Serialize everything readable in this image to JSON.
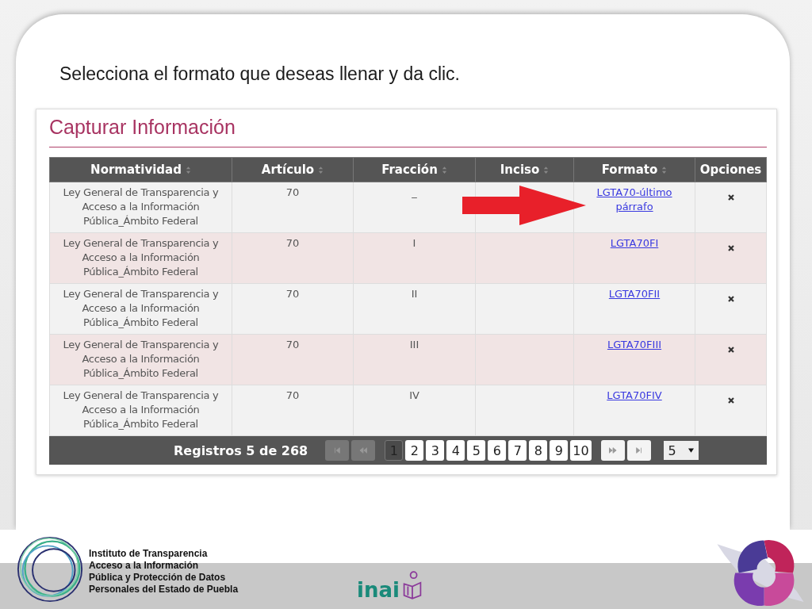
{
  "instruction": "Selecciona el formato que deseas llenar y da clic.",
  "panel": {
    "title": "Capturar Información",
    "table": {
      "columns": [
        {
          "label": "Normatividad",
          "sortable": true
        },
        {
          "label": "Artículo",
          "sortable": true
        },
        {
          "label": "Fracción",
          "sortable": true
        },
        {
          "label": "Inciso",
          "sortable": true
        },
        {
          "label": "Formato",
          "sortable": true
        },
        {
          "label": "Opciones",
          "sortable": false
        }
      ],
      "rows": [
        {
          "normatividad": "Ley General de Transparencia y Acceso a la Información Pública_Ámbito Federal",
          "articulo": "70",
          "fraccion": "_",
          "inciso": "",
          "formato": "LGTA70-último párrafo",
          "pointed": true
        },
        {
          "normatividad": "Ley General de Transparencia y Acceso a la Información Pública_Ámbito Federal",
          "articulo": "70",
          "fraccion": "I",
          "inciso": "",
          "formato": "LGTA70FI",
          "pointed": false
        },
        {
          "normatividad": "Ley General de Transparencia y Acceso a la Información Pública_Ámbito Federal",
          "articulo": "70",
          "fraccion": "II",
          "inciso": "",
          "formato": "LGTA70FII",
          "pointed": false
        },
        {
          "normatividad": "Ley General de Transparencia y Acceso a la Información Pública_Ámbito Federal",
          "articulo": "70",
          "fraccion": "III",
          "inciso": "",
          "formato": "LGTA70FIII",
          "pointed": false
        },
        {
          "normatividad": "Ley General de Transparencia y Acceso a la Información Pública_Ámbito Federal",
          "articulo": "70",
          "fraccion": "IV",
          "inciso": "",
          "formato": "LGTA70FIV",
          "pointed": false
        }
      ]
    },
    "pager": {
      "summary": "Registros 5 de 268",
      "nav_before": [
        {
          "kind": "first",
          "disabled": true
        },
        {
          "kind": "prev",
          "disabled": true
        }
      ],
      "pages": [
        {
          "label": "1",
          "selected": true
        },
        {
          "label": "2",
          "selected": false
        },
        {
          "label": "3",
          "selected": false
        },
        {
          "label": "4",
          "selected": false
        },
        {
          "label": "5",
          "selected": false
        },
        {
          "label": "6",
          "selected": false
        },
        {
          "label": "7",
          "selected": false
        },
        {
          "label": "8",
          "selected": false
        },
        {
          "label": "9",
          "selected": false
        },
        {
          "label": "10",
          "selected": false
        }
      ],
      "nav_after": [
        {
          "kind": "next",
          "disabled": false
        },
        {
          "kind": "last",
          "disabled": false
        }
      ],
      "page_size": "5"
    }
  },
  "footer": {
    "org_lines": [
      "Instituto de Transparencia",
      "Acceso a la Información",
      "Pública y Protección de Datos",
      "Personales del Estado de Puebla"
    ],
    "brand": "inai"
  }
}
